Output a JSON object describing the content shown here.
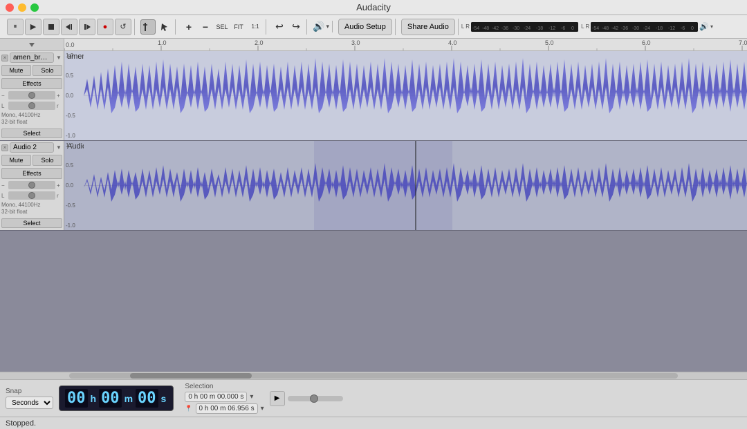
{
  "app": {
    "title": "Audacity"
  },
  "toolbar": {
    "pause_label": "⏸",
    "play_label": "▶",
    "stop_label": "■",
    "back_label": "⏮",
    "fwd_label": "⏭",
    "record_label": "●",
    "loop_label": "↺",
    "audio_setup_label": "Audio Setup",
    "share_audio_label": "Share Audio",
    "tool_cursor": "I",
    "tool_select": "✎",
    "zoom_in": "+",
    "zoom_out": "−",
    "zoom_sel": "⊡",
    "zoom_fit": "⊞",
    "zoom_reset": "1:1",
    "undo": "↩",
    "redo": "↪"
  },
  "meter": {
    "input_label": "L\nR",
    "input_ticks": [
      "-54",
      "-48",
      "-42",
      "-36",
      "-30",
      "-24",
      "-18",
      "-12",
      "-6",
      "0"
    ],
    "output_label": "L\nR",
    "output_ticks": [
      "-54",
      "-48",
      "-42",
      "-36",
      "-30",
      "-24",
      "-18",
      "-12",
      "-6",
      "0"
    ]
  },
  "ruler": {
    "ticks": [
      {
        "pos": 0,
        "label": "0.0"
      },
      {
        "pos": 140,
        "label": "1.0"
      },
      {
        "pos": 278,
        "label": "2.0"
      },
      {
        "pos": 417,
        "label": "3.0"
      },
      {
        "pos": 556,
        "label": "4.0"
      },
      {
        "pos": 694,
        "label": "5.0"
      },
      {
        "pos": 833,
        "label": "6.0"
      },
      {
        "pos": 971,
        "label": "7.0"
      }
    ]
  },
  "track1": {
    "name": "amen_break",
    "close_btn": "×",
    "collapse_btn": "▼",
    "mute_label": "Mute",
    "solo_label": "Solo",
    "effects_label": "Effects",
    "gain_label_minus": "−",
    "gain_label_plus": "+",
    "pan_label_l": "L",
    "pan_label_r": "r",
    "info": "Mono, 44100Hz\n32-bit float",
    "select_label": "Select",
    "y_labels": [
      "1.0",
      "0.5",
      "0.0",
      "-0.5",
      "-1.0"
    ],
    "waveform_color": "#4444cc",
    "bg_color": "#c8ccdd"
  },
  "track2": {
    "name": "Audio 2",
    "close_btn": "×",
    "collapse_btn": "▼",
    "mute_label": "Mute",
    "solo_label": "Solo",
    "effects_label": "Effects",
    "gain_label_minus": "−",
    "gain_label_plus": "+",
    "pan_label_l": "L",
    "pan_label_r": "r",
    "info": "Mono, 44100Hz\n32-bit float",
    "select_label": "Select",
    "y_labels": [
      "1.0",
      "0.5",
      "0.0",
      "-0.5",
      "-1.0"
    ],
    "waveform_color": "#4444cc",
    "bg_color": "#b0b4c8"
  },
  "bottom": {
    "snap_label": "Snap",
    "seconds_label": "Seconds",
    "time_h": "00",
    "time_m": "00",
    "time_s": "00",
    "h_label": "h",
    "m_label": "m",
    "s_label": "s",
    "selection_label": "Selection",
    "sel_start": "0 h 00 m 00.000 s",
    "sel_end": "0 h 00 m 06.956 s",
    "play_slider_min": "0",
    "play_slider_max": "100",
    "play_slider_val": "50"
  },
  "status": {
    "text": "Stopped."
  }
}
